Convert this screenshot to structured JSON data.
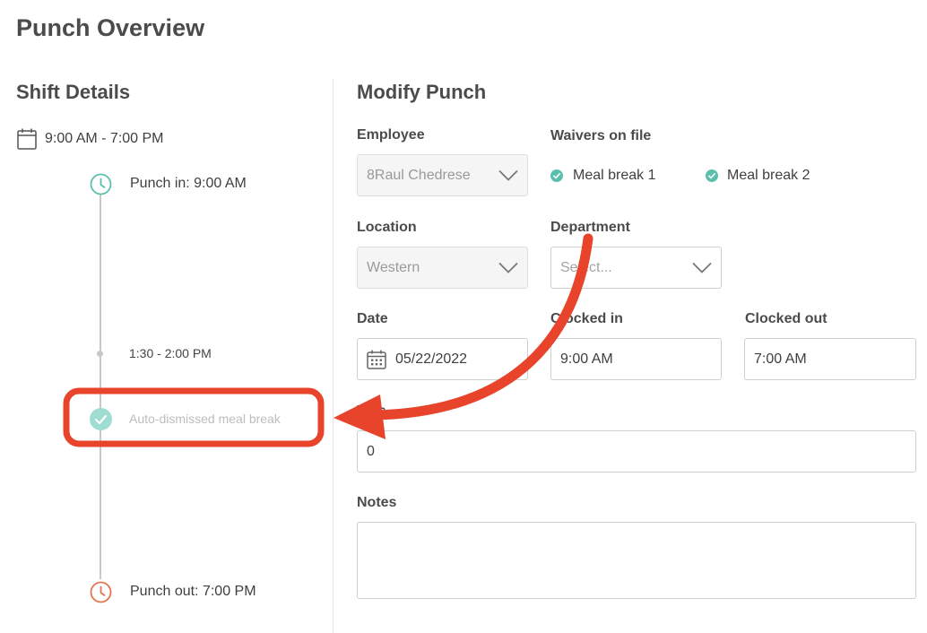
{
  "page": {
    "title": "Punch Overview"
  },
  "shift": {
    "title": "Shift Details",
    "time_range": "9:00 AM - 7:00 PM",
    "timeline": {
      "punch_in": "Punch in: 9:00 AM",
      "break_time": "1:30 - 2:00 PM",
      "auto_dismissed": "Auto-dismissed meal break",
      "punch_out": "Punch out: 7:00 PM"
    }
  },
  "modify": {
    "title": "Modify Punch",
    "employee": {
      "label": "Employee",
      "value": "8Raul Chedrese"
    },
    "waivers": {
      "label": "Waivers on file",
      "items": [
        "Meal break 1",
        "Meal break 2"
      ]
    },
    "location": {
      "label": "Location",
      "value": "Western"
    },
    "department": {
      "label": "Department",
      "placeholder": "Select..."
    },
    "date": {
      "label": "Date",
      "value": "05/22/2022"
    },
    "clocked_in": {
      "label": "Clocked in",
      "value": "9:00 AM"
    },
    "clocked_out": {
      "label": "Clocked out",
      "value": "7:00 AM"
    },
    "tips": {
      "label": "Tips",
      "value": "0"
    },
    "notes": {
      "label": "Notes",
      "value": ""
    }
  },
  "colors": {
    "accent_teal": "#5bbfae",
    "punch_out_orange": "#e8734f",
    "annotation_red": "#e8432b"
  }
}
